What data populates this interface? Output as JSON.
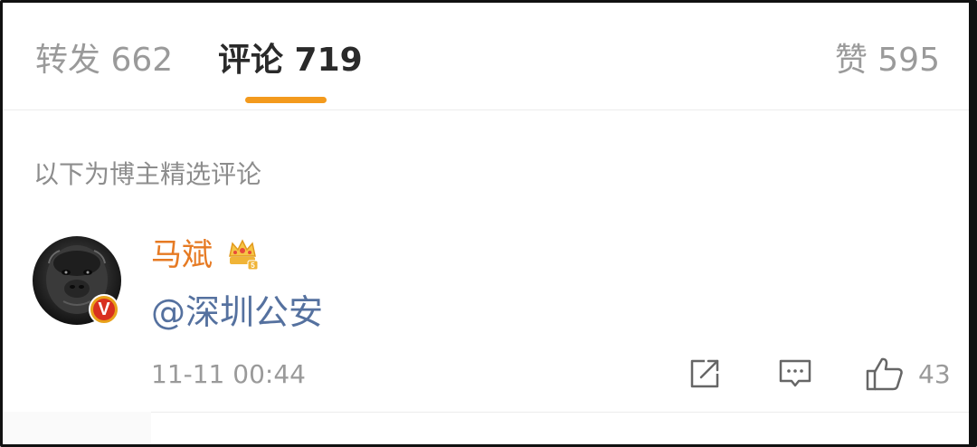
{
  "tabs": {
    "repost": "转发 662",
    "comments": "评论 719",
    "likes": "赞 595",
    "active": "comments",
    "accent_color": "#f39a1d"
  },
  "section": {
    "title": "以下为博主精选评论"
  },
  "comment": {
    "avatar_icon": "gorilla-avatar",
    "verified_badge": "V",
    "username": "马斌",
    "username_color": "#e67a23",
    "vip_icon": "crown-vip-icon",
    "text": "@深圳公安",
    "text_color": "#55719f",
    "timestamp": "11-11 00:44",
    "like_count": "43"
  },
  "actions": {
    "share_icon": "share-icon",
    "reply_icon": "reply-icon",
    "like_icon": "thumbs-up-icon"
  }
}
